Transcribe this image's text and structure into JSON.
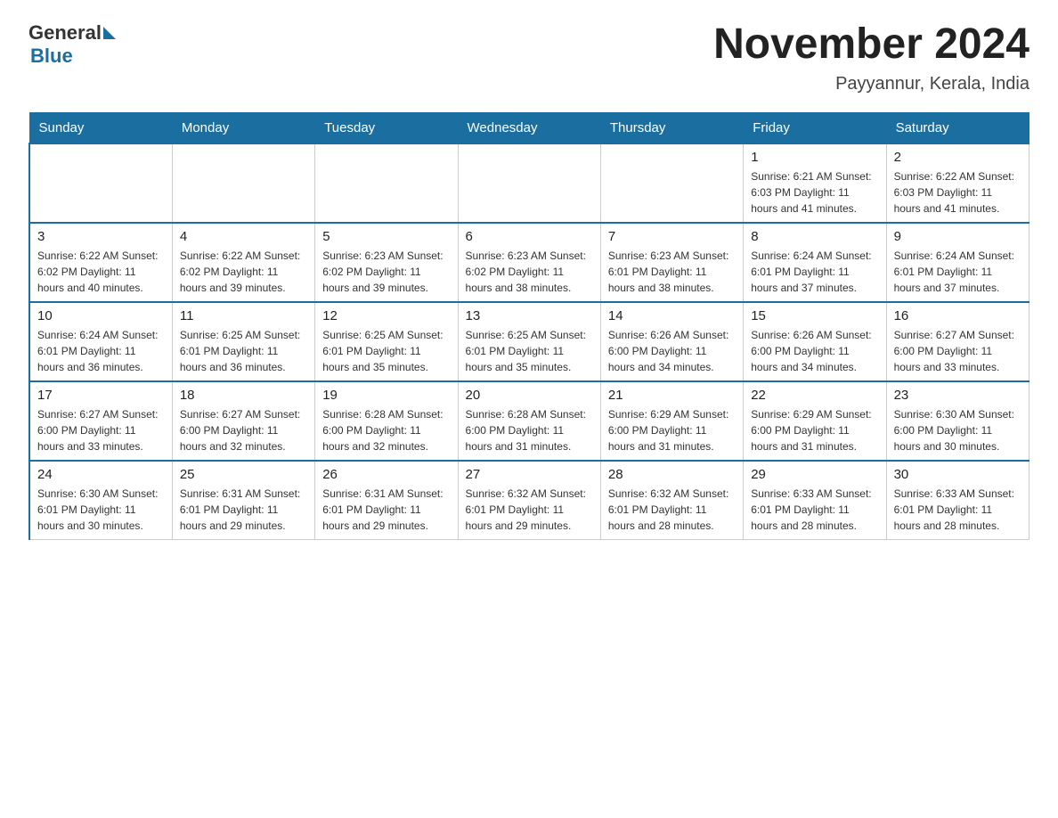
{
  "header": {
    "logo_text_general": "General",
    "logo_text_blue": "Blue",
    "title": "November 2024",
    "subtitle": "Payyannur, Kerala, India"
  },
  "days_of_week": [
    "Sunday",
    "Monday",
    "Tuesday",
    "Wednesday",
    "Thursday",
    "Friday",
    "Saturday"
  ],
  "weeks": [
    [
      {
        "day": "",
        "info": ""
      },
      {
        "day": "",
        "info": ""
      },
      {
        "day": "",
        "info": ""
      },
      {
        "day": "",
        "info": ""
      },
      {
        "day": "",
        "info": ""
      },
      {
        "day": "1",
        "info": "Sunrise: 6:21 AM\nSunset: 6:03 PM\nDaylight: 11 hours and 41 minutes."
      },
      {
        "day": "2",
        "info": "Sunrise: 6:22 AM\nSunset: 6:03 PM\nDaylight: 11 hours and 41 minutes."
      }
    ],
    [
      {
        "day": "3",
        "info": "Sunrise: 6:22 AM\nSunset: 6:02 PM\nDaylight: 11 hours and 40 minutes."
      },
      {
        "day": "4",
        "info": "Sunrise: 6:22 AM\nSunset: 6:02 PM\nDaylight: 11 hours and 39 minutes."
      },
      {
        "day": "5",
        "info": "Sunrise: 6:23 AM\nSunset: 6:02 PM\nDaylight: 11 hours and 39 minutes."
      },
      {
        "day": "6",
        "info": "Sunrise: 6:23 AM\nSunset: 6:02 PM\nDaylight: 11 hours and 38 minutes."
      },
      {
        "day": "7",
        "info": "Sunrise: 6:23 AM\nSunset: 6:01 PM\nDaylight: 11 hours and 38 minutes."
      },
      {
        "day": "8",
        "info": "Sunrise: 6:24 AM\nSunset: 6:01 PM\nDaylight: 11 hours and 37 minutes."
      },
      {
        "day": "9",
        "info": "Sunrise: 6:24 AM\nSunset: 6:01 PM\nDaylight: 11 hours and 37 minutes."
      }
    ],
    [
      {
        "day": "10",
        "info": "Sunrise: 6:24 AM\nSunset: 6:01 PM\nDaylight: 11 hours and 36 minutes."
      },
      {
        "day": "11",
        "info": "Sunrise: 6:25 AM\nSunset: 6:01 PM\nDaylight: 11 hours and 36 minutes."
      },
      {
        "day": "12",
        "info": "Sunrise: 6:25 AM\nSunset: 6:01 PM\nDaylight: 11 hours and 35 minutes."
      },
      {
        "day": "13",
        "info": "Sunrise: 6:25 AM\nSunset: 6:01 PM\nDaylight: 11 hours and 35 minutes."
      },
      {
        "day": "14",
        "info": "Sunrise: 6:26 AM\nSunset: 6:00 PM\nDaylight: 11 hours and 34 minutes."
      },
      {
        "day": "15",
        "info": "Sunrise: 6:26 AM\nSunset: 6:00 PM\nDaylight: 11 hours and 34 minutes."
      },
      {
        "day": "16",
        "info": "Sunrise: 6:27 AM\nSunset: 6:00 PM\nDaylight: 11 hours and 33 minutes."
      }
    ],
    [
      {
        "day": "17",
        "info": "Sunrise: 6:27 AM\nSunset: 6:00 PM\nDaylight: 11 hours and 33 minutes."
      },
      {
        "day": "18",
        "info": "Sunrise: 6:27 AM\nSunset: 6:00 PM\nDaylight: 11 hours and 32 minutes."
      },
      {
        "day": "19",
        "info": "Sunrise: 6:28 AM\nSunset: 6:00 PM\nDaylight: 11 hours and 32 minutes."
      },
      {
        "day": "20",
        "info": "Sunrise: 6:28 AM\nSunset: 6:00 PM\nDaylight: 11 hours and 31 minutes."
      },
      {
        "day": "21",
        "info": "Sunrise: 6:29 AM\nSunset: 6:00 PM\nDaylight: 11 hours and 31 minutes."
      },
      {
        "day": "22",
        "info": "Sunrise: 6:29 AM\nSunset: 6:00 PM\nDaylight: 11 hours and 31 minutes."
      },
      {
        "day": "23",
        "info": "Sunrise: 6:30 AM\nSunset: 6:00 PM\nDaylight: 11 hours and 30 minutes."
      }
    ],
    [
      {
        "day": "24",
        "info": "Sunrise: 6:30 AM\nSunset: 6:01 PM\nDaylight: 11 hours and 30 minutes."
      },
      {
        "day": "25",
        "info": "Sunrise: 6:31 AM\nSunset: 6:01 PM\nDaylight: 11 hours and 29 minutes."
      },
      {
        "day": "26",
        "info": "Sunrise: 6:31 AM\nSunset: 6:01 PM\nDaylight: 11 hours and 29 minutes."
      },
      {
        "day": "27",
        "info": "Sunrise: 6:32 AM\nSunset: 6:01 PM\nDaylight: 11 hours and 29 minutes."
      },
      {
        "day": "28",
        "info": "Sunrise: 6:32 AM\nSunset: 6:01 PM\nDaylight: 11 hours and 28 minutes."
      },
      {
        "day": "29",
        "info": "Sunrise: 6:33 AM\nSunset: 6:01 PM\nDaylight: 11 hours and 28 minutes."
      },
      {
        "day": "30",
        "info": "Sunrise: 6:33 AM\nSunset: 6:01 PM\nDaylight: 11 hours and 28 minutes."
      }
    ]
  ]
}
